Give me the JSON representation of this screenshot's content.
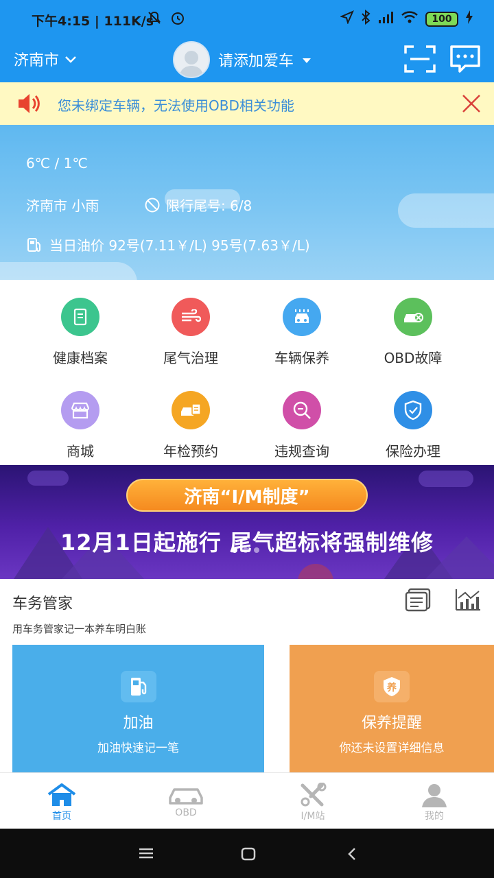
{
  "status_bar": {
    "time_speed": "下午4:15 | 111K/s",
    "battery": "100"
  },
  "header": {
    "city": "济南市",
    "car_prompt": "请添加爱车"
  },
  "notice": {
    "text": "您未绑定车辆，无法使用OBD相关功能"
  },
  "weather": {
    "temperature": "6℃ / 1℃",
    "condition": "济南市 小雨",
    "restriction": "限行尾号: 6/8",
    "fuel_price": "当日油价 92号(7.11￥/L) 95号(7.63￥/L)"
  },
  "services": [
    {
      "label": "健康档案",
      "icon": "health-record-icon",
      "color": "#3cc58e"
    },
    {
      "label": "尾气治理",
      "icon": "exhaust-icon",
      "color": "#f05a5a"
    },
    {
      "label": "车辆保养",
      "icon": "car-wash-icon",
      "color": "#45a8f0"
    },
    {
      "label": "OBD故障",
      "icon": "obd-fault-icon",
      "color": "#5cc05c"
    },
    {
      "label": "商城",
      "icon": "shop-icon",
      "color": "#b49cf0"
    },
    {
      "label": "年检预约",
      "icon": "inspection-icon",
      "color": "#f5a623"
    },
    {
      "label": "违规查询",
      "icon": "violation-icon",
      "color": "#d04fa8"
    },
    {
      "label": "保险办理",
      "icon": "insurance-icon",
      "color": "#2f8fe6"
    }
  ],
  "banner": {
    "pill_text": "济南“I/M制度”",
    "main_text": "12月1日起施行 尾气超标将强制维修",
    "slides_total": 3,
    "slide_active": 1
  },
  "butler": {
    "title": "车务管家",
    "subtitle": "用车务管家记一本养车明白账",
    "cards": [
      {
        "title": "加油",
        "subtitle": "加油快速记一笔",
        "color": "#4aaeea",
        "icon": "fuel-pump-icon"
      },
      {
        "title": "保养提醒",
        "subtitle": "你还未设置详细信息",
        "color": "#f0a050",
        "icon": "maintenance-shield-icon",
        "icon_char": "养"
      }
    ]
  },
  "bottom_nav": [
    {
      "label": "首页",
      "icon": "home-icon",
      "active": true
    },
    {
      "label": "OBD",
      "icon": "car-icon",
      "active": false
    },
    {
      "label": "I/M站",
      "icon": "tools-icon",
      "active": false
    },
    {
      "label": "我的",
      "icon": "profile-icon",
      "active": false
    }
  ],
  "colors": {
    "primary": "#1e96f0",
    "active_nav": "#1e8de8",
    "inactive_nav": "#b5b5b5"
  }
}
